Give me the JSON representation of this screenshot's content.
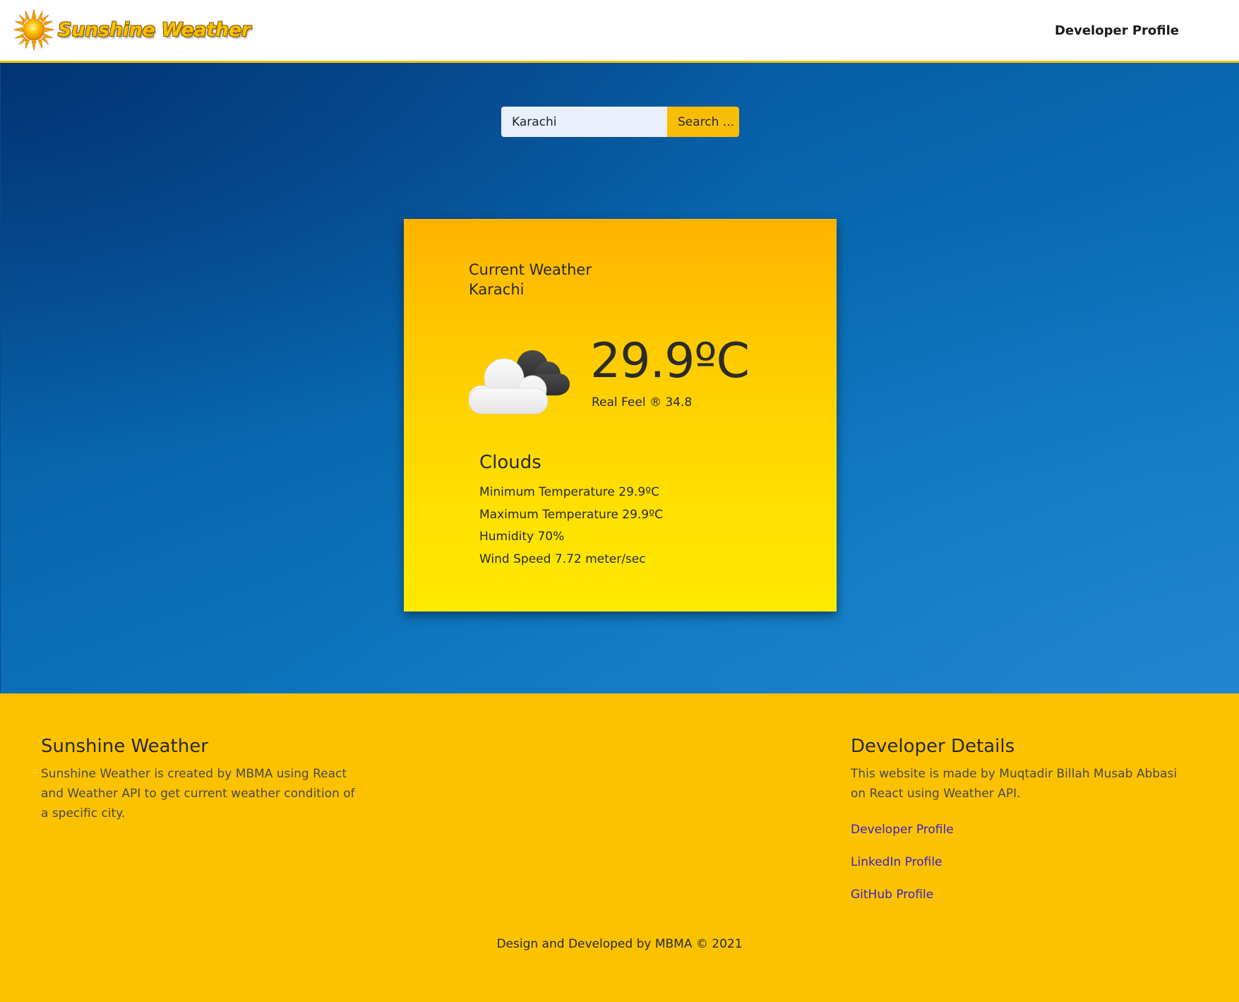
{
  "header": {
    "brand_name": "Sunshine Weather",
    "brand_icon": "sun-icon",
    "nav_link": "Developer Profile"
  },
  "search": {
    "value": "Karachi",
    "button_label": "Search ..."
  },
  "weather": {
    "heading": "Current Weather",
    "city": "Karachi",
    "icon": "cloudy-icon",
    "temperature": "29.9ºC",
    "real_feel": "Real Feel ® 34.8",
    "condition": "Clouds",
    "details": [
      "Minimum Temperature 29.9ºC",
      "Maximum Temperature 29.9ºC",
      "Humidity 70%",
      "Wind Speed 7.72 meter/sec"
    ]
  },
  "footer": {
    "about_title": "Sunshine Weather",
    "about_text": "Sunshine Weather is created by MBMA using React and Weather API to get current weather condition of a specific city.",
    "dev_title": "Developer Details",
    "dev_text": "This website is made by Muqtadir Billah Musab Abbasi on React using Weather API.",
    "links": [
      "Developer Profile",
      "LinkedIn Profile",
      "GitHub Profile"
    ],
    "copyright": "Design and Developed by MBMA © 2021"
  },
  "colors": {
    "header_accent": "#f2c200",
    "sky_blue": "#0866ad",
    "card_top": "#ffb300",
    "card_bottom": "#ffea00",
    "footer_bg": "#fcc200",
    "link": "#3b1fcc",
    "search_button": "#f8bd05"
  }
}
